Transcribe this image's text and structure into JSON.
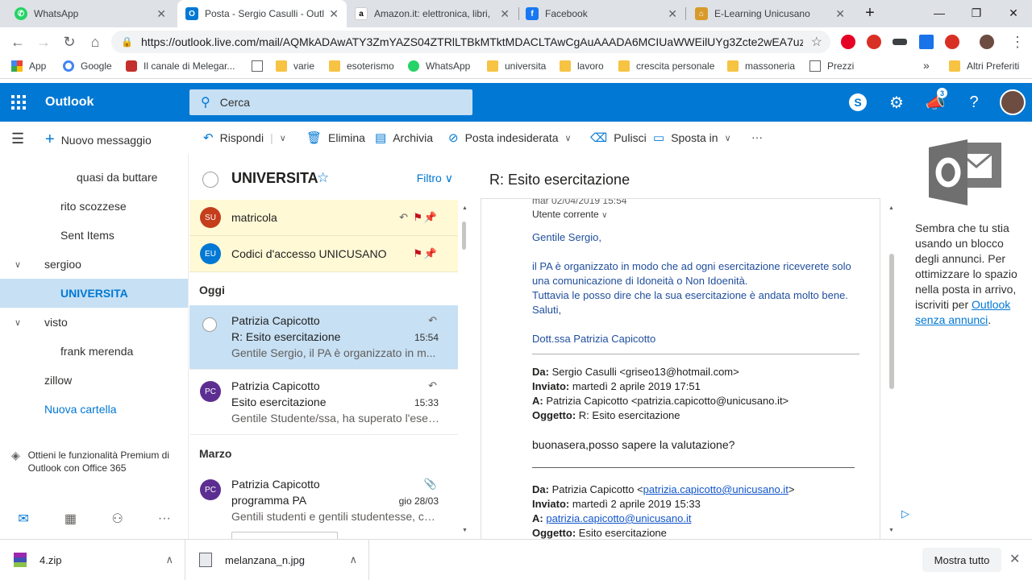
{
  "browser": {
    "tabs": [
      {
        "title": "WhatsApp",
        "color": "#25d366",
        "glyph": "W"
      },
      {
        "title": "Posta - Sergio Casulli - Outl",
        "color": "#0078d4",
        "glyph": "O"
      },
      {
        "title": "Amazon.it: elettronica, libri,",
        "color": "#ffffff",
        "glyph": "a"
      },
      {
        "title": "Facebook",
        "color": "#1877f2",
        "glyph": "f"
      },
      {
        "title": "E-Learning Unicusano",
        "color": "#f0a500",
        "glyph": "⌂"
      }
    ],
    "url": "https://outlook.live.com/mail/AQMkADAwATY3ZmYAZS04ZTRlLTBkMTktMDACLTAwCgAuAAADA6MCIUaWWEilUYg3Zcte2wEA7uzq...",
    "bookmarks": [
      {
        "label": "App",
        "icon": "apps-icon"
      },
      {
        "label": "Google",
        "icon": "google-icon"
      },
      {
        "label": "Il canale di Melegar...",
        "icon": "youtube-icon"
      },
      {
        "label": "",
        "icon": "page-icon"
      },
      {
        "label": "varie",
        "icon": "folder-icon"
      },
      {
        "label": "esoterismo",
        "icon": "folder-icon"
      },
      {
        "label": "WhatsApp",
        "icon": "whatsapp-icon"
      },
      {
        "label": "universita",
        "icon": "folder-icon"
      },
      {
        "label": "lavoro",
        "icon": "folder-icon"
      },
      {
        "label": "crescita personale",
        "icon": "folder-icon"
      },
      {
        "label": "massoneria",
        "icon": "folder-icon"
      },
      {
        "label": "Prezzi",
        "icon": "page-icon"
      }
    ],
    "bookmarks_more": "»",
    "other_bookmarks": "Altri Preferiti"
  },
  "outlook": {
    "brand": "Outlook",
    "search_placeholder": "Cerca",
    "notification_count": "3",
    "new_message": "Nuovo messaggio",
    "commands": {
      "reply": "Rispondi",
      "delete": "Elimina",
      "archive": "Archivia",
      "junk": "Posta indesiderata",
      "sweep": "Pulisci",
      "move": "Sposta in",
      "more": "···"
    },
    "folders": [
      {
        "label": "quasi da buttare"
      },
      {
        "label": "rito scozzese"
      },
      {
        "label": "Sent Items"
      },
      {
        "label": "sergioo"
      },
      {
        "label": "UNIVERSITA"
      },
      {
        "label": "visto"
      },
      {
        "label": "frank merenda"
      },
      {
        "label": "zillow"
      },
      {
        "label": "Nuova cartella"
      }
    ],
    "premium_text": "Ottieni le funzionalità Premium di Outlook con Office 365",
    "list": {
      "folder_name": "UNIVERSITA",
      "filter": "Filtro",
      "pinned": [
        {
          "initials": "SU",
          "subject": "matricola",
          "color": "#c43e1c"
        },
        {
          "initials": "EU",
          "subject": "Codici d'accesso UNICUSANO",
          "color": "#0078d4"
        }
      ],
      "group_today": "Oggi",
      "group_march": "Marzo",
      "messages": [
        {
          "from": "Patrizia Capicotto",
          "subject": "R: Esito esercitazione",
          "time": "15:54",
          "preview": "Gentile Sergio, il PA è organizzato in m..."
        },
        {
          "from": "Patrizia Capicotto",
          "subject": "Esito esercitazione",
          "time": "15:33",
          "preview": "Gentile Studente/ssa, ha superato l'eser...",
          "initials": "PC"
        },
        {
          "from": "Patrizia Capicotto",
          "subject": "programma PA",
          "time": "gio 28/03",
          "preview": "Gentili studenti e gentili studentesse, co...",
          "initials": "PC"
        }
      ]
    },
    "reading": {
      "title": "R: Esito esercitazione",
      "date_partial": "mar 02/04/2019 15:54",
      "to_line": "Utente corrente",
      "greeting": "Gentile Sergio,",
      "body1": "il PA è organizzato in modo che ad ogni esercitazione riceverete solo",
      "body2": "una comunicazione di Idoneità o Non Idoenità.",
      "body3": "Tuttavia le posso dire che la sua esercitazione è andata molto bene.",
      "body4": "Saluti,",
      "signature": "Dott.ssa Patrizia Capicotto",
      "q1": {
        "da_label": "Da:",
        "da": "Sergio Casulli <griseo13@hotmail.com>",
        "inviato_label": "Inviato:",
        "inviato": "martedì 2 aprile 2019 17:51",
        "a_label": "A:",
        "a": "Patrizia Capicotto <patrizia.capicotto@unicusano.it>",
        "oggetto_label": "Oggetto:",
        "oggetto": "R: Esito esercitazione"
      },
      "question": "buonasera,posso sapere la valutazione?",
      "q2": {
        "da_label": "Da:",
        "da_name": "Patrizia Capicotto <",
        "da_email": "patrizia.capicotto@unicusano.it",
        "da_end": ">",
        "inviato_label": "Inviato:",
        "inviato": "martedì 2 aprile 2019 15:33",
        "a_label": "A:",
        "a_email": "patrizia.capicotto@unicusano.it",
        "oggetto_label": "Oggetto:",
        "oggetto": "Esito esercitazione"
      }
    },
    "ad": {
      "text": "Sembra che tu stia usando un blocco degli annunci. Per ottimizzare lo spazio nella posta in arrivo, iscriviti per",
      "link": "Outlook senza annunci",
      "end": "."
    }
  },
  "downloads": {
    "items": [
      {
        "name": "4.zip"
      },
      {
        "name": "melanzana_n.jpg"
      }
    ],
    "show_all": "Mostra tutto"
  }
}
